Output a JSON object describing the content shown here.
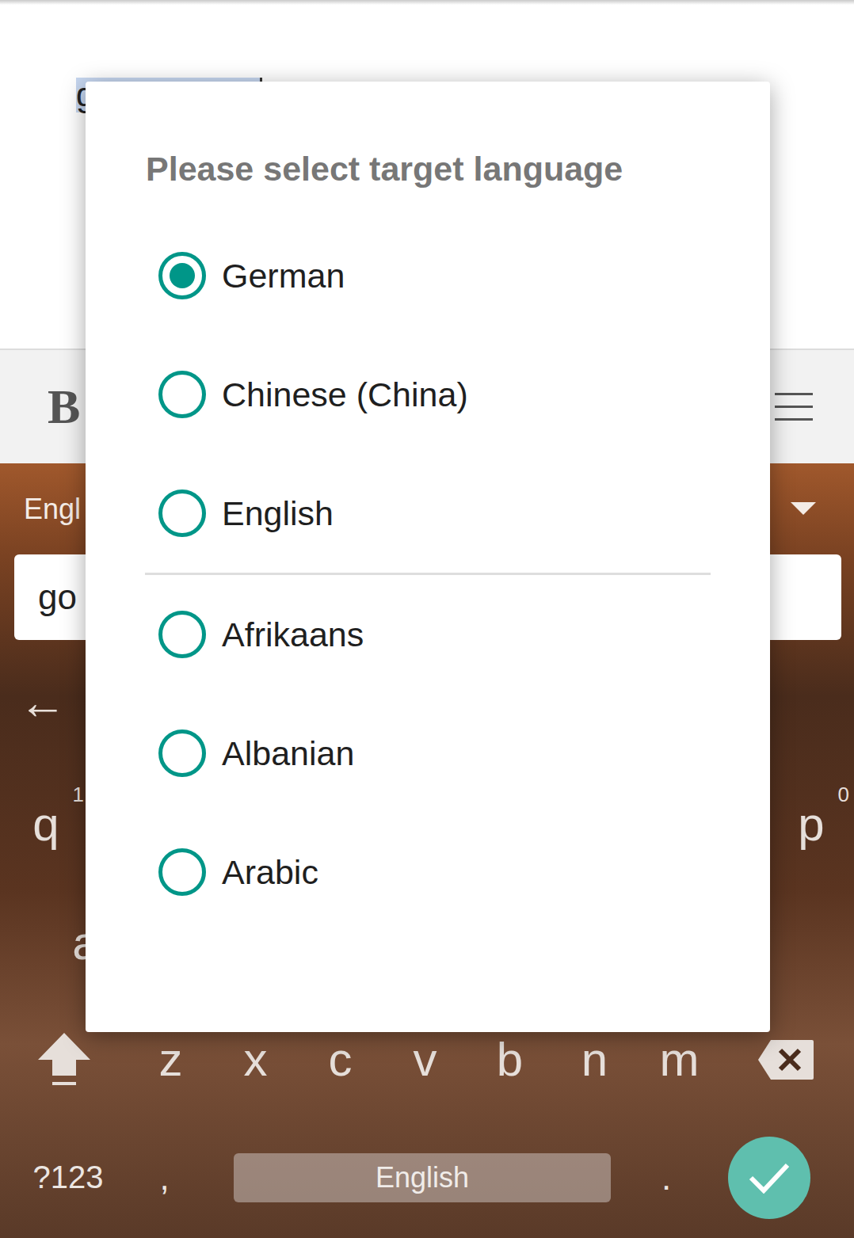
{
  "editor": {
    "text": "g",
    "selected": true
  },
  "toolbar": {
    "bold": "B"
  },
  "keyboard": {
    "language": "Engl",
    "input": "go",
    "back": "←",
    "top_row": [
      {
        "key": "q",
        "hint": "1"
      },
      {
        "key": "p",
        "hint": "0"
      }
    ],
    "middle_row": [
      {
        "key": "a"
      }
    ],
    "bottom_letters": [
      "z",
      "x",
      "c",
      "v",
      "b",
      "n",
      "m"
    ],
    "bottom_row": {
      "symbols": "?123",
      "comma": ",",
      "space": "English",
      "period": "."
    }
  },
  "dialog": {
    "title": "Please select target language",
    "groups": [
      [
        {
          "label": "German",
          "selected": true
        },
        {
          "label": "Chinese (China)",
          "selected": false
        },
        {
          "label": "English",
          "selected": false
        }
      ],
      [
        {
          "label": "Afrikaans",
          "selected": false
        },
        {
          "label": "Albanian",
          "selected": false
        },
        {
          "label": "Arabic",
          "selected": false
        }
      ]
    ]
  }
}
